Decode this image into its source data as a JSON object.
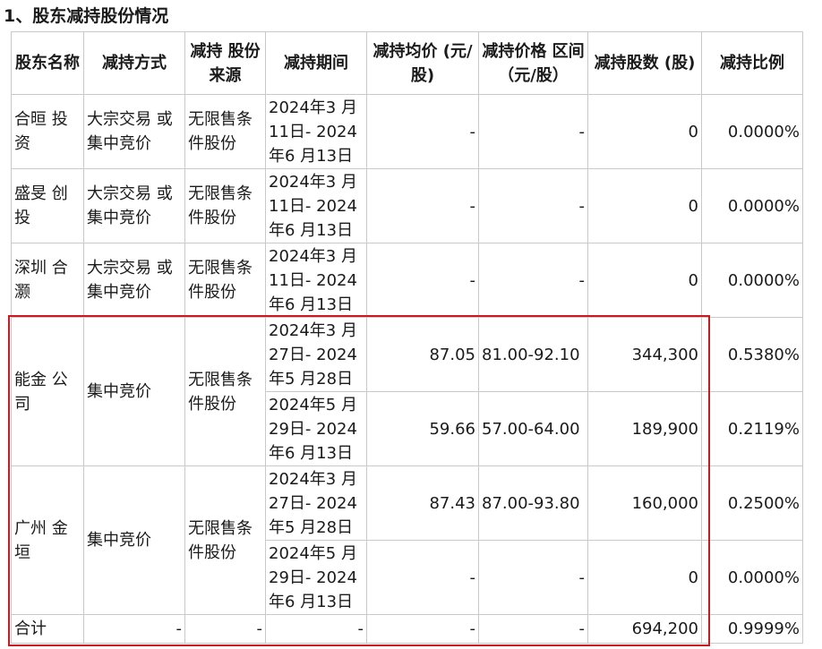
{
  "heading": "1、股东减持股份情况",
  "table": {
    "headers": [
      "股东名称",
      "减持方式",
      "减持 股份 来源",
      "减持期间",
      "减持均价 (元/股)",
      "减持价格 区间 （元/股）",
      "减持股数 (股)",
      "减持比例"
    ],
    "rows": [
      {
        "holder": "合晅 投资",
        "method": "大宗交易 或集中竞价",
        "source": "无限售条件股份",
        "period": "2024年3 月11日- 2024年6 月13日",
        "avg": "-",
        "range": "-",
        "shares": "0",
        "ratio": "0.0000%"
      },
      {
        "holder": "盛旻 创投",
        "method": "大宗交易 或集中竞价",
        "source": "无限售条件股份",
        "period": "2024年3 月11日- 2024年6 月13日",
        "avg": "-",
        "range": "-",
        "shares": "0",
        "ratio": "0.0000%"
      },
      {
        "holder": "深圳 合灏",
        "method": "大宗交易 或集中竞价",
        "source": "无限售条件股份",
        "period": "2024年3 月11日- 2024年6 月13日",
        "avg": "-",
        "range": "-",
        "shares": "0",
        "ratio": "0.0000%"
      },
      {
        "holder": "能金 公司",
        "method": "集中竞价",
        "source": "无限售条件股份",
        "period": "2024年3 月27日- 2024年5 月28日",
        "avg": "87.05",
        "range": "81.00-92.10",
        "shares": "344,300",
        "ratio": "0.5380%"
      },
      {
        "period": "2024年5 月29日- 2024年6 月13日",
        "avg": "59.66",
        "range": "57.00-64.00",
        "shares": "189,900",
        "ratio": "0.2119%"
      },
      {
        "holder": "广州 金垣",
        "method": "集中竞价",
        "source": "无限售条件股份",
        "period": "2024年3 月27日- 2024年5 月28日",
        "avg": "87.43",
        "range": "87.00-93.80",
        "shares": "160,000",
        "ratio": "0.2500%"
      },
      {
        "period": "2024年5 月29日- 2024年6 月13日",
        "avg": "-",
        "range": "-",
        "shares": "0",
        "ratio": "0.0000%"
      }
    ],
    "total": {
      "holder": "合计",
      "method": "-",
      "source": "-",
      "period": "-",
      "avg": "-",
      "range": "-",
      "shares": "694,200",
      "ratio": "0.9999%"
    }
  }
}
